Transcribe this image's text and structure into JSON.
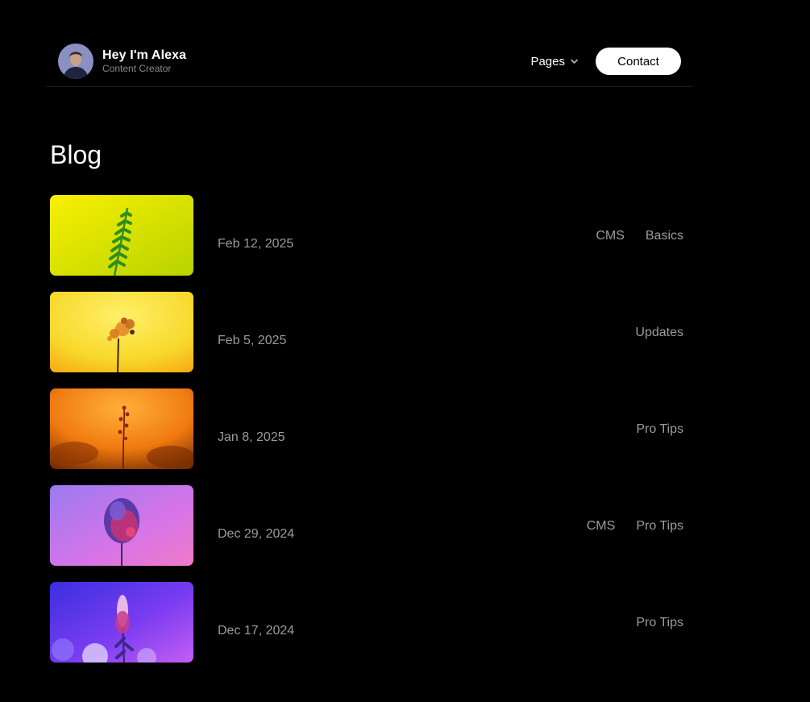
{
  "header": {
    "name": "Hey I'm Alexa",
    "role": "Content Creator",
    "nav": {
      "pages_label": "Pages",
      "contact_label": "Contact"
    }
  },
  "page": {
    "title": "Blog"
  },
  "posts": [
    {
      "date": "Feb 12, 2025",
      "tags": [
        "CMS",
        "Basics"
      ],
      "image": "yellow-fern"
    },
    {
      "date": "Feb 5, 2025",
      "tags": [
        "Updates"
      ],
      "image": "yellow-orange-wildflower"
    },
    {
      "date": "Jan 8, 2025",
      "tags": [
        "Pro Tips"
      ],
      "image": "orange-flower-bokeh"
    },
    {
      "date": "Dec 29, 2024",
      "tags": [
        "CMS",
        "Pro Tips"
      ],
      "image": "purple-allium-flower"
    },
    {
      "date": "Dec 17, 2024",
      "tags": [
        "Pro Tips"
      ],
      "image": "blue-purple-lupine"
    }
  ],
  "colors": {
    "background": "#000000",
    "muted_text": "#9b9b9b",
    "button_bg": "#ffffff"
  }
}
